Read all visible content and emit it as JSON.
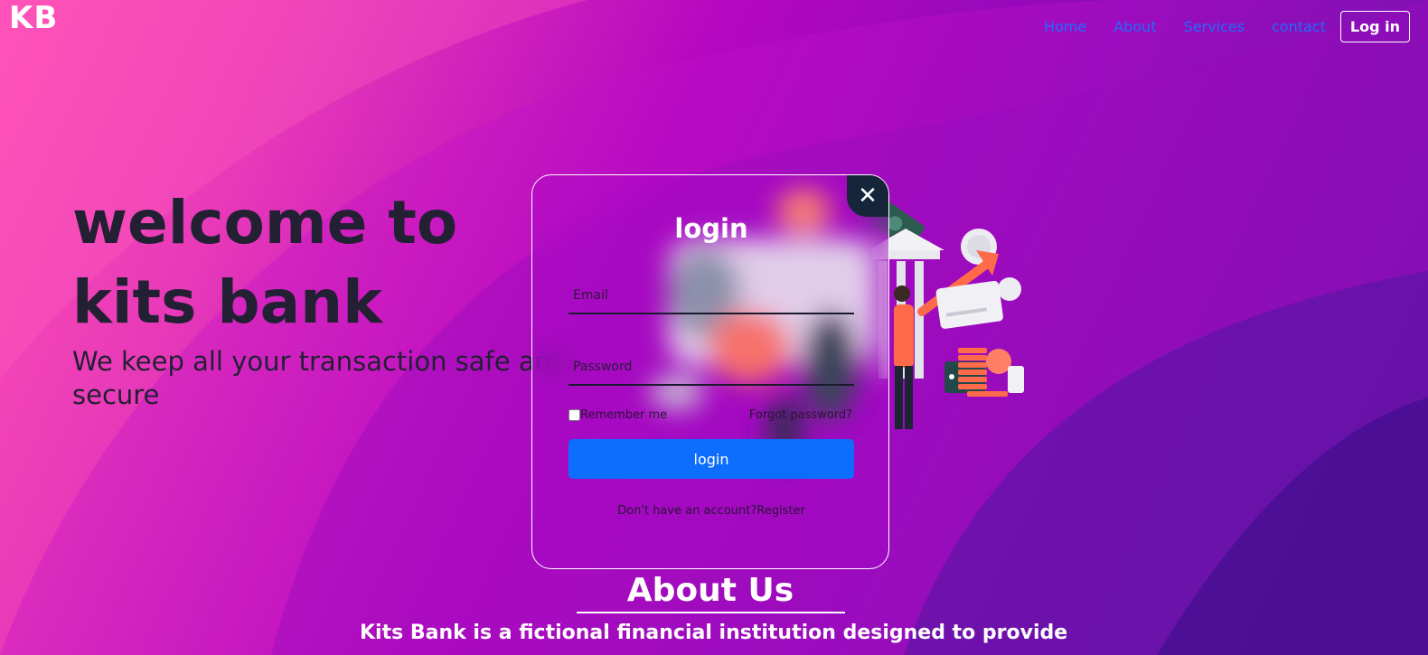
{
  "brand": {
    "logo": "KB"
  },
  "nav": {
    "items": [
      "Home",
      "About",
      "Services",
      "contact"
    ],
    "login_button": "Log in"
  },
  "hero": {
    "title": "welcome to kits bank",
    "subtitle": "We keep all your transaction safe and secure"
  },
  "modal": {
    "title": "login",
    "close_icon": "close-icon",
    "email_placeholder": "Email",
    "password_placeholder": "Password",
    "remember_label": "Remember me",
    "forgot_label": "Forgot password?",
    "submit_label": "login",
    "no_account_text": "Don't have an account?",
    "register_label": "Register"
  },
  "about": {
    "title": "About Us",
    "text": "Kits Bank is a fictional financial institution designed to provide"
  },
  "colors": {
    "nav_link": "#1f6cff",
    "primary_button": "#0d6efd",
    "close_bg": "#16263a",
    "hero_text": "#232034"
  }
}
